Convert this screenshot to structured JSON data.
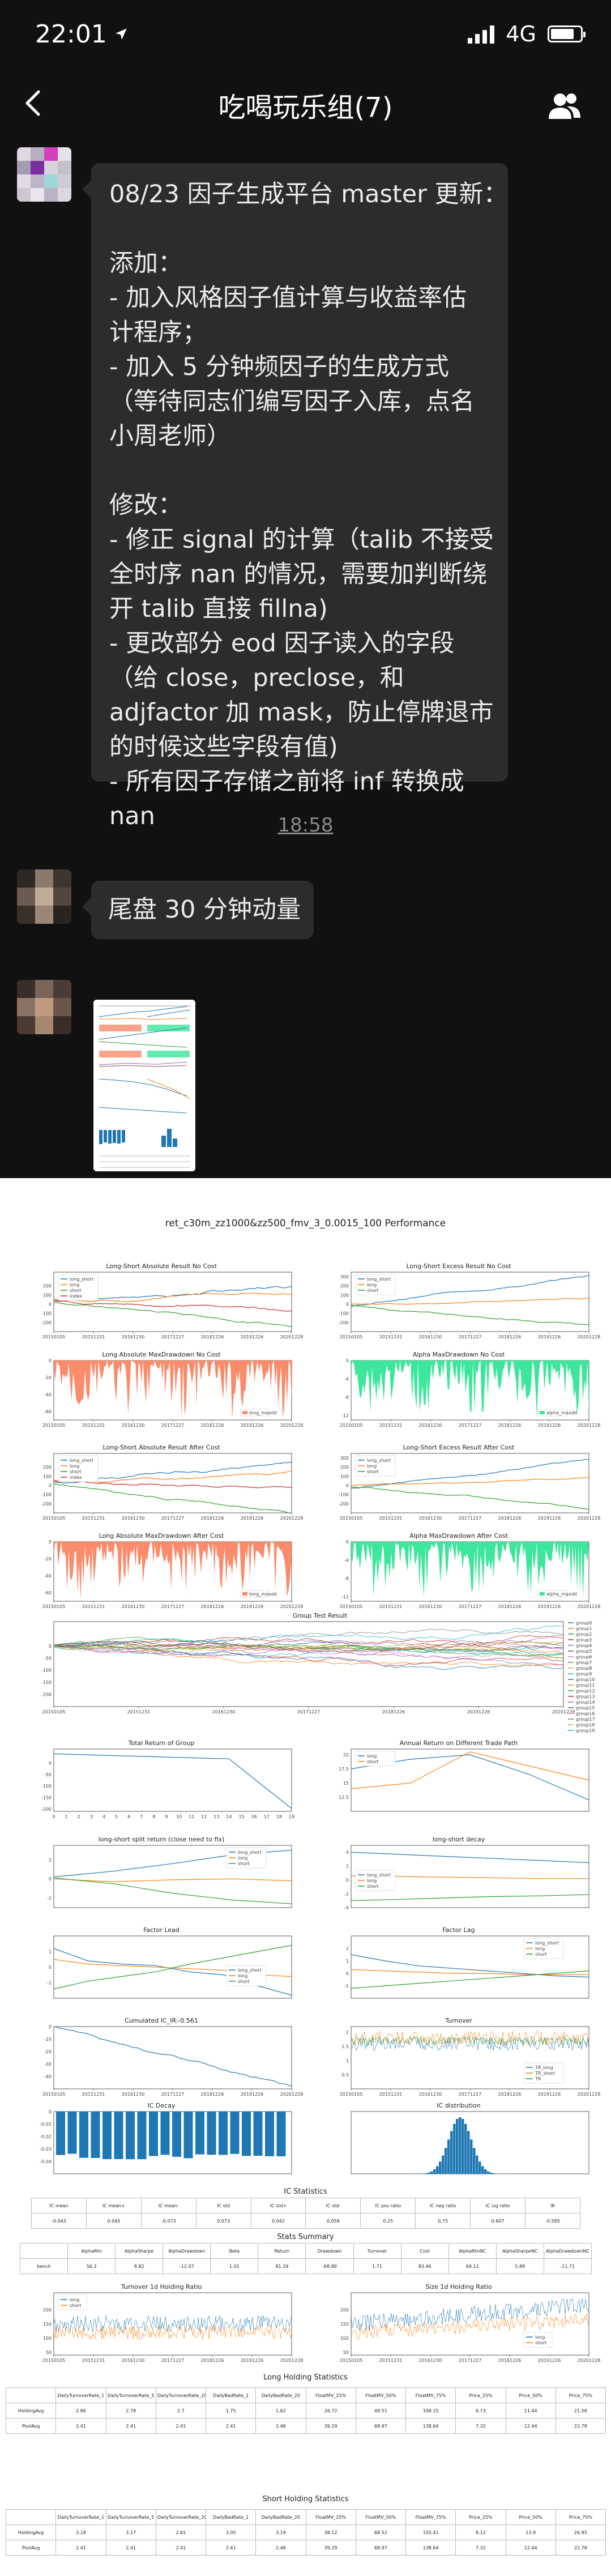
{
  "status_bar": {
    "time": "22:01",
    "network": "4G",
    "battery_level": 0.8
  },
  "nav": {
    "title": "吃喝玩乐组(7)",
    "back_icon": "chevron-left-icon",
    "more_icon": "group-members-icon"
  },
  "messages": [
    {
      "type": "text",
      "lines": [
        "08/23 因子生成平台 master 更新：",
        "",
        "添加：",
        "- 加入风格因子值计算与收益率估",
        "计程序；",
        "- 加入 5 分钟频因子的生成方式",
        "（等待同志们编写因子入库，点名",
        "小周老师）",
        "",
        "修改：",
        "- 修正 signal 的计算（talib 不接受",
        "全时序 nan 的情况，需要加判断绕",
        "开 talib 直接 fillna)",
        "- 更改部分 eod 因子读入的字段",
        "（给 close，preclose，和",
        "adjfactor 加 mask，防止停牌退市",
        "的时候这些字段有值)",
        "- 所有因子存储之前将 inf 转换成",
        "nan"
      ]
    },
    {
      "type": "timestamp",
      "text": "18:58"
    },
    {
      "type": "text",
      "lines": [
        "尾盘 30 分钟动量"
      ]
    },
    {
      "type": "image",
      "description_icon": "report-thumbnail-icon"
    }
  ],
  "report": {
    "title": "ret_c30m_zz1000&zz500_fmv_3_0.0015_100 Performance",
    "colors": {
      "long_short": "#1f77b4",
      "long": "#ff7f0e",
      "short": "#2ca02c",
      "index": "#d62728",
      "drawdown_a": "#fa8c6b",
      "drawdown_b": "#3ce69a",
      "ic_bar": "#1f77b4"
    },
    "dates": [
      "20150105",
      "20151231",
      "20161230",
      "20171227",
      "20181226",
      "20191226",
      "20201228"
    ],
    "panels": [
      {
        "title": "Long-Short Absolute Result No Cost",
        "legend": [
          "long_short",
          "long",
          "short",
          "index"
        ]
      },
      {
        "title": "Long-Short Excess Result No Cost",
        "legend": [
          "long_short",
          "long",
          "short"
        ]
      },
      {
        "title": "Long Absolute MaxDrawdown No Cost",
        "legend": [
          "long_maxdd"
        ]
      },
      {
        "title": "Alpha MaxDrawdown No Cost",
        "legend": [
          "alpha_maxdd"
        ]
      },
      {
        "title": "Long-Short Absolute Result After Cost",
        "legend": [
          "long_short",
          "long",
          "short",
          "index"
        ]
      },
      {
        "title": "Long-Short Excess Result After Cost",
        "legend": [
          "long_short",
          "long",
          "short"
        ]
      },
      {
        "title": "Long Absolute MaxDrawdown After Cost",
        "legend": [
          "long_maxdd"
        ]
      },
      {
        "title": "Alpha MaxDrawdown After Cost",
        "legend": [
          "alpha_maxdd"
        ]
      },
      {
        "title": "Group Test Result",
        "legend": [
          "group0",
          "group1",
          "group2",
          "group3",
          "group4",
          "group5",
          "group6",
          "group7",
          "group8",
          "group9",
          "group10",
          "group11",
          "group12",
          "group13",
          "group14",
          "group15",
          "group16",
          "group17",
          "group18",
          "group19"
        ]
      },
      {
        "title": "Total Return of Group",
        "legend": []
      },
      {
        "title": "Annual Return on Different Trade Path",
        "legend": [
          "long",
          "short"
        ]
      },
      {
        "title": "long-short split return (close need to fix)",
        "legend": [
          "long_short",
          "long",
          "short"
        ]
      },
      {
        "title": "long-short decay",
        "legend": [
          "long_short",
          "long",
          "short"
        ]
      },
      {
        "title": "Factor Lead",
        "legend": [
          "long_short",
          "long",
          "short"
        ]
      },
      {
        "title": "Factor Lag",
        "legend": [
          "long_short",
          "long",
          "short"
        ]
      },
      {
        "title": "Cumulated IC_IR:-0.561",
        "legend": []
      },
      {
        "title": "Turnover",
        "legend": [
          "TR_long",
          "TR_short",
          "TR"
        ]
      },
      {
        "title": "IC Decay",
        "legend": []
      },
      {
        "title": "IC distribution",
        "legend": []
      }
    ],
    "ic_stats": {
      "title": "IC Statistics",
      "headers": [
        "IC mean",
        "IC mean+",
        "IC mean-",
        "IC std",
        "IC std+",
        "IC std-",
        "IC pos ratio",
        "IC neg ratio",
        "IC sig ratio",
        "IR"
      ],
      "values": [
        "-0.043",
        "0.045",
        "-0.073",
        "0.073",
        "0.042",
        "0.058",
        "0.25",
        "0.75",
        "0.607",
        "-0.585"
      ]
    },
    "stats_summary": {
      "title": "Stats Summary",
      "headers": [
        "AlphaRtn",
        "AlphaSharpe",
        "AlphaDrawdown",
        "Beta",
        "Return",
        "Drawdown",
        "Turnover",
        "Cost",
        "AlphaRtnNC",
        "AlphaSharpeNC",
        "AlphaDrawdownNC"
      ],
      "row_label": "bench",
      "values": [
        "56.3",
        "8.82",
        "-12.07",
        "1.01",
        "81.29",
        "-68.89",
        "1.71",
        "83.46",
        "69.12",
        "5.89",
        "-11.71"
      ]
    },
    "turnover_panels": [
      {
        "title": "Turnover 1d Holding Ratio",
        "legend": [
          "long",
          "short"
        ]
      },
      {
        "title": "Size 1d Holding Ratio",
        "legend": [
          "long",
          "short"
        ]
      }
    ],
    "long_holding": {
      "title": "Long Holding Statistics",
      "headers": [
        "DailyTurnoverRate_1",
        "DailyTurnoverRate_5",
        "DailyTurnoverRate_20",
        "DailyBadRate_1",
        "DailyBadRate_20",
        "FloatMV_25%",
        "FloatMV_50%",
        "FloatMV_75%",
        "Price_25%",
        "Price_50%",
        "Price_75%"
      ],
      "rows": [
        {
          "label": "HoldingAvg",
          "values": [
            "2.86",
            "2.78",
            "2.7",
            "1.75",
            "1.62",
            "26.72",
            "49.51",
            "108.15",
            "6.73",
            "11.44",
            "21.56"
          ]
        },
        {
          "label": "PoolAvg",
          "values": [
            "2.41",
            "2.41",
            "2.41",
            "2.41",
            "2.46",
            "39.29",
            "68.97",
            "138.64",
            "7.32",
            "12.44",
            "22.78"
          ]
        }
      ]
    },
    "short_holding": {
      "title": "Short Holding Statistics",
      "headers": [
        "DailyTurnoverRate_1",
        "DailyTurnoverRate_5",
        "DailyTurnoverRate_20",
        "DailyBadRate_1",
        "DailyBadRate_20",
        "FloatMV_25%",
        "FloatMV_50%",
        "FloatMV_75%",
        "Price_25%",
        "Price_50%",
        "Price_75%"
      ],
      "rows": [
        {
          "label": "HoldingAvg",
          "values": [
            "3.18",
            "3.17",
            "2.81",
            "3.05",
            "3.19",
            "38.12",
            "68.52",
            "155.41",
            "8.12",
            "13.9",
            "26.85"
          ]
        },
        {
          "label": "PoolAvg",
          "values": [
            "2.41",
            "2.41",
            "2.41",
            "2.41",
            "2.46",
            "39.29",
            "68.97",
            "138.64",
            "7.32",
            "12.44",
            "22.78"
          ]
        }
      ]
    }
  }
}
